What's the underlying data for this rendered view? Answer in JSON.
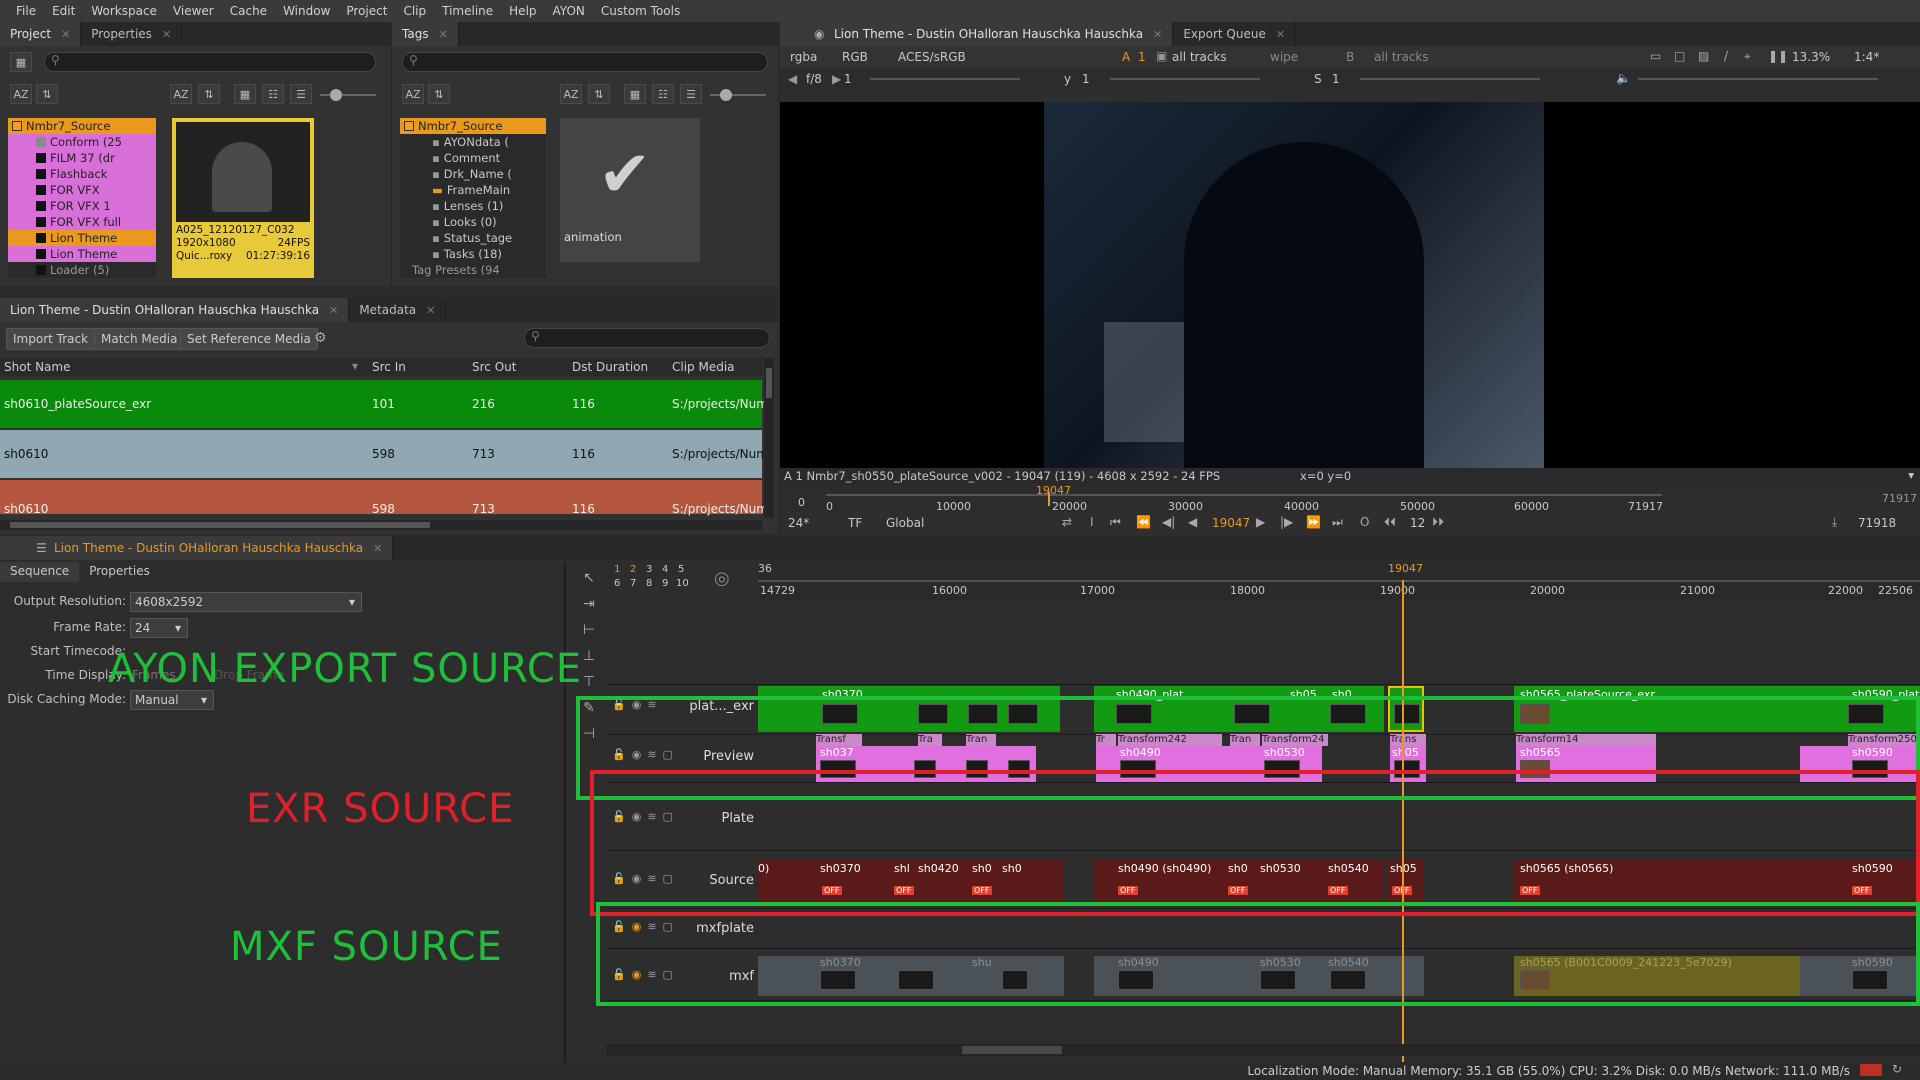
{
  "menu": [
    "File",
    "Edit",
    "Workspace",
    "Viewer",
    "Cache",
    "Window",
    "Project",
    "Clip",
    "Timeline",
    "Help",
    "AYON",
    "Custom Tools"
  ],
  "project_panel": {
    "tabs": [
      "Project",
      "Properties"
    ],
    "tree": [
      {
        "label": "Nmbr7_Source",
        "color": "#f0a020"
      },
      {
        "label": "Conform (25",
        "color": "#8a8a8a"
      },
      {
        "label": "FILM 37 (dr",
        "color": "#111111"
      },
      {
        "label": "Flashback",
        "color": "#111111"
      },
      {
        "label": "FOR VFX",
        "color": "#111111"
      },
      {
        "label": "FOR VFX 1",
        "color": "#111111"
      },
      {
        "label": "FOR VFX full",
        "color": "#111111"
      },
      {
        "label": "Lion Theme",
        "color": "#111111"
      },
      {
        "label": "Lion Theme",
        "color": "#111111"
      },
      {
        "label": "Loader (5)",
        "color": "#111111"
      }
    ],
    "clip": {
      "name": "A025_12120127_C032",
      "res": "1920x1080",
      "fps": "24FPS",
      "codec": "Quic...roxy",
      "tc": "01:27:39:16"
    }
  },
  "tags_panel": {
    "tabs": [
      "Tags"
    ],
    "tree": [
      "Nmbr7_Source",
      "AYONdata (",
      "Comment",
      "Drk_Name (",
      "FrameMain",
      "Lenses (1)",
      "Looks (0)",
      "Status_tage",
      "Tasks (18)",
      "Tag Presets (94"
    ],
    "tile_label": "animation"
  },
  "shot_panel": {
    "tabs": [
      "Lion Theme - Dustin OHalloran Hauschka Hauschka",
      "Metadata"
    ],
    "buttons": [
      "Import Track",
      "Match Media",
      "Set Reference Media"
    ],
    "columns": [
      "Shot Name",
      "Src In",
      "Src Out",
      "Dst Duration",
      "Clip Media"
    ],
    "rows": [
      {
        "name": "sh0610_plateSource_exr",
        "src_in": "101",
        "src_out": "216",
        "dur": "116",
        "media": "S:/projects/Num",
        "color": "#0a8a0a"
      },
      {
        "name": "sh0610",
        "src_in": "598",
        "src_out": "713",
        "dur": "116",
        "media": "S:/projects/Num",
        "color": "#8fa8b2"
      },
      {
        "name": "sh0610",
        "src_in": "598",
        "src_out": "713",
        "dur": "116",
        "media": "S:/projects/Num",
        "color": "#b5573f"
      }
    ]
  },
  "viewer": {
    "tabs": [
      "Lion Theme - Dustin OHalloran Hauschka Hauschka",
      "Export Queue"
    ],
    "toolbar": {
      "channels": "rgba",
      "mode": "RGB",
      "colorspace": "ACES/sRGB",
      "track_a": "A",
      "track_num": "1",
      "tracks_a": "all tracks",
      "wipe": "wipe",
      "track_b": "B",
      "tracks_b": "all tracks",
      "zoom": "13.3%",
      "ratio": "1:4*"
    },
    "toolbar2": {
      "fstop": "f/8",
      "x_val": "1",
      "y_label": "y",
      "y_val": "1",
      "s_label": "S",
      "s_val": "1"
    },
    "info": "A 1 Nmbr7_sh0550_plateSource_v002 - 19047 (119) - 4608 x 2592 - 24 FPS",
    "coords": "x=0 y=0",
    "ruler": {
      "start": "0",
      "marks": [
        "0",
        "10000",
        "20000",
        "30000",
        "40000",
        "50000",
        "60000",
        "71917"
      ],
      "current": "19047",
      "end_label": "71917",
      "end2": "71918"
    },
    "transport": {
      "fps": "24*",
      "tf": "TF",
      "global": "Global",
      "frame": "19047",
      "step": "12"
    }
  },
  "timeline": {
    "tab": "Lion Theme - Dustin OHalloran Hauschka Hauschka",
    "subtabs": [
      "Sequence",
      "Properties"
    ],
    "props": {
      "output_resolution_label": "Output Resolution:",
      "output_resolution": "4608x2592",
      "frame_rate_label": "Frame Rate:",
      "frame_rate": "24",
      "start_tc_label": "Start Timecode:",
      "time_display_label": "Time Display:",
      "time_display": "Frames",
      "drop_frame": "Drop Frame",
      "disk_caching_label": "Disk Caching Mode:",
      "disk_caching": "Manual"
    },
    "ruler": {
      "start": "14729",
      "marks": [
        "16000",
        "17000",
        "18000",
        "19000",
        "20000",
        "21000",
        "22000",
        "22506"
      ],
      "current": "19047",
      "small": "36"
    },
    "version_nums": [
      "1",
      "2",
      "3",
      "4",
      "5",
      "6",
      "7",
      "8",
      "9",
      "10"
    ],
    "tracks": [
      "plat..._exr",
      "Preview",
      "Plate",
      "Source",
      "mxfplate",
      "mxf"
    ],
    "clips_exr": [
      "sh0370",
      "Transf",
      "Tra",
      "Tran",
      "Tr",
      "Transf",
      "Transform242",
      "Tran",
      "Transform24",
      "Trans",
      "sh0490_plat",
      "sh05",
      "sh0",
      "sh0565_plateSource_exr",
      "Transform14",
      "sh0590_plat",
      "Transform250"
    ],
    "clips_preview": [
      "sh037",
      "sh0",
      "sh0",
      "sh04",
      "sh0490",
      "sh0",
      "sh0530",
      "sh05",
      "sh0565",
      "sh0590"
    ],
    "clips_source": [
      "0)",
      "sh0370",
      "shl",
      "sh0420",
      "sh0",
      "sh0",
      "sh0490 (sh0490)",
      "sh0",
      "sh0530",
      "sh0540",
      "sh05",
      "sh0565 (sh0565)",
      "sh0590"
    ],
    "clips_mxf": [
      "sh0370",
      "sh0490",
      "shu",
      "sh0530",
      "sh0540",
      "sh0565 (B001C0009_241223_5e7029)",
      "sh0590"
    ],
    "off_label": "OFF"
  },
  "overlays": {
    "ayon": "AYON EXPORT SOURCE",
    "exr": "EXR SOURCE",
    "mxf": "MXF SOURCE",
    "green": "#1fbf3a",
    "red": "#e0202a"
  },
  "status_bar": "Localization Mode: Manual  Memory: 35.1 GB (55.0%) CPU: 3.2% Disk: 0.0 MB/s Network: 111.0 MB/s"
}
